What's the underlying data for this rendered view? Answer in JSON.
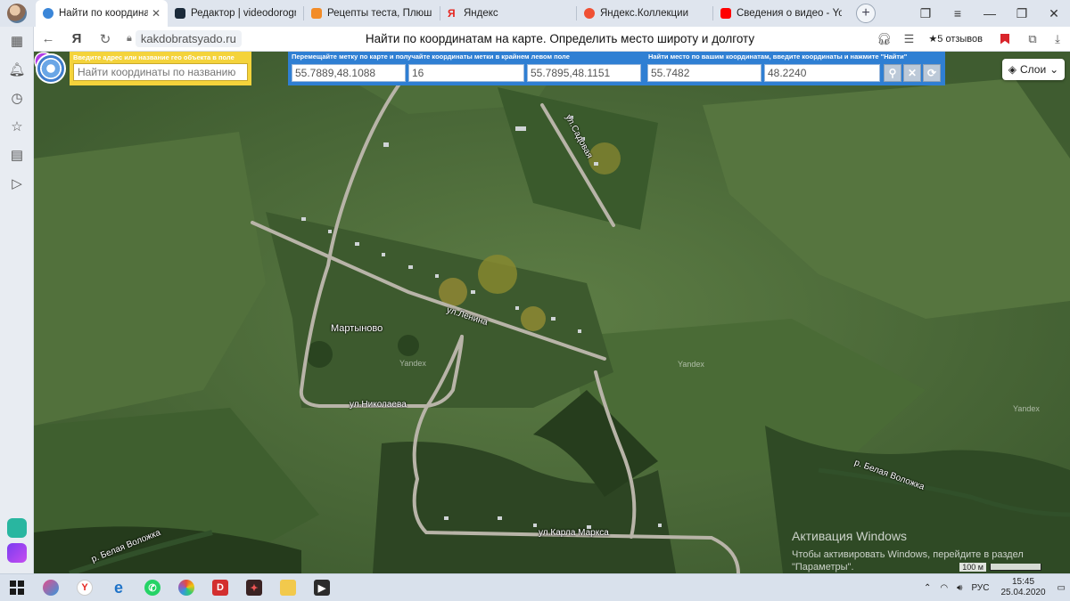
{
  "browser": {
    "tabs": [
      {
        "label": "Найти по координатам",
        "active": true,
        "favicon_color": "#3b86d8",
        "close": "✕"
      },
      {
        "label": "Редактор | videodorogros",
        "favicon_color": "#1b2a3a"
      },
      {
        "label": "Рецепты теста, Плюшка и",
        "favicon_color": "#f28c28"
      },
      {
        "label": "Яндекс",
        "favicon_color": "#e52620"
      },
      {
        "label": "Яндекс.Коллекции",
        "favicon_color": "#f05033"
      },
      {
        "label": "Сведения о видео - YouTu",
        "favicon_color": "#ff0000"
      }
    ],
    "new_tab": "+",
    "address": {
      "domain": "kakdobratsyado.ru",
      "page_title": "Найти по координатам на карте. Определить место широту и долготу",
      "reviews": "★5 отзывов"
    }
  },
  "map": {
    "search_panel": {
      "hint": "Введите адрес или название гео объекта в поле",
      "placeholder": "Найти координаты по названию"
    },
    "coord_panel": {
      "hint_left": "Перемещайте метку по карте и получайте координаты метки в крайнем левом поле",
      "hint_right": "Найти место по вашим координатам, введите координаты и нажмите \"Найти\"",
      "marker_coords": "55.7889,48.1088",
      "zoom": "16",
      "center_coords": "55.7895,48.1151",
      "lat": "55.7482",
      "lon": "48.2240"
    },
    "layers_label": "Слои",
    "village_label": "Мартыново",
    "street_labels": {
      "ul_lenina": "ул.Ленина",
      "ul_nikolaeva": "ул.Николаева",
      "ul_karla_marksa": "ул.Карла Маркса",
      "ul_top": "ул.Садовая"
    },
    "river_labels": {
      "right": "р. Белая Воложка",
      "left": "р. Белая Воложка"
    },
    "yandex_marks": [
      "Yandex",
      "Yandex",
      "Yandex"
    ],
    "scale": "100 м",
    "watermark": {
      "title": "Активация Windows",
      "text_line1": "Чтобы активировать Windows, перейдите в раздел",
      "text_line2": "\"Параметры\"."
    }
  },
  "taskbar": {
    "lang": "РУС",
    "time": "15:45",
    "date": "25.04.2020"
  }
}
